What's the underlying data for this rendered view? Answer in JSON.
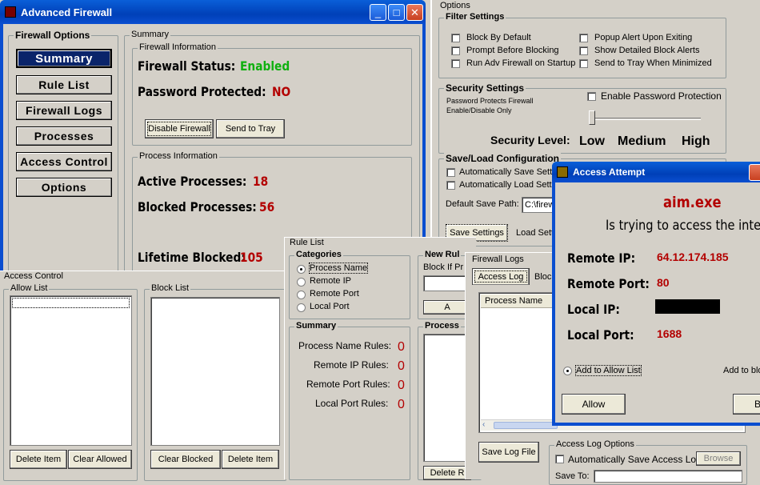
{
  "main_window": {
    "title": "Advanced Firewall",
    "nav_group": "Firewall Options",
    "nav": [
      "Summary",
      "Rule List",
      "Firewall Logs",
      "Processes",
      "Access Control",
      "Options"
    ],
    "summary_group": "Summary",
    "fw_info_group": "Firewall Information",
    "status_label": "Firewall Status:",
    "status_value": "Enabled",
    "password_label": "Password Protected:",
    "password_value": "NO",
    "disable_btn": "Disable Firewall",
    "tray_btn": "Send to Tray",
    "proc_info_group": "Process Information",
    "active_label": "Active Processes:",
    "active_value": "18",
    "blocked_label": "Blocked Processes:",
    "blocked_value": "56",
    "lifetime_label": "Lifetime Blocked:",
    "lifetime_value": "105"
  },
  "options_window": {
    "title": "Options",
    "filter_group": "Filter Settings",
    "filters": [
      "Block By Default",
      "Prompt Before Blocking",
      "Run Adv Firewall on Startup",
      "Popup Alert Upon Exiting",
      "Show Detailed Block Alerts",
      "Send to Tray When Minimized"
    ],
    "security_group": "Security Settings",
    "security_note1": "Password Protects Firewall",
    "security_note2": "Enable/Disable Only",
    "enable_pw": "Enable Password Protection",
    "level_label": "Security Level:",
    "levels": [
      "Low",
      "Medium",
      "High"
    ],
    "security_level": "Low",
    "saveload_group": "Save/Load Configuration",
    "auto_save": "Automatically Save Setti",
    "auto_load": "Automatically Load Settir",
    "save_path_label": "Default Save Path:",
    "save_path_value": "C:\\firew",
    "save_btn": "Save Settings",
    "load_btn": "Load Setti"
  },
  "access_control": {
    "title": "Access Control",
    "allow_group": "Allow List",
    "block_group": "Block List",
    "delete_item": "Delete Item",
    "clear_allowed": "Clear Allowed",
    "clear_blocked": "Clear Blocked"
  },
  "rule_list": {
    "title": "Rule List",
    "categories_group": "Categories",
    "categories": [
      "Process Name",
      "Remote IP",
      "Remote Port",
      "Local Port"
    ],
    "selected_category": "Process Name",
    "new_rule_group": "New Rul",
    "block_if": "Block If Pr",
    "summary_group": "Summary",
    "summary_rows": [
      {
        "label": "Process Name Rules:",
        "value": "0"
      },
      {
        "label": "Remote IP Rules:",
        "value": "0"
      },
      {
        "label": "Remote Port Rules:",
        "value": "0"
      },
      {
        "label": "Local Port Rules:",
        "value": "0"
      }
    ],
    "process_group": "Process",
    "delete_btn": "Delete R",
    "add_btn": "A"
  },
  "firewall_logs": {
    "title": "Firewall Logs",
    "tabs": [
      "Access Log",
      "Block"
    ],
    "column": "Process Name",
    "save_log": "Save Log File",
    "options_group": "Access Log Options",
    "auto_save_log": "Automatically Save Access Log",
    "browse": "Browse",
    "save_to": "Save To:"
  },
  "alert": {
    "title": "Access Attempt",
    "process": "aim.exe",
    "message": "Is trying to access the internet",
    "remote_ip_label": "Remote IP:",
    "remote_ip": "64.12.174.185",
    "remote_port_label": "Remote Port:",
    "remote_port": "80",
    "local_ip_label": "Local IP:",
    "local_port_label": "Local Port:",
    "local_port": "1688",
    "add_allow": "Add to Allow List",
    "add_block": "Add to blo",
    "allow_btn": "Allow",
    "block_btn": "B"
  }
}
